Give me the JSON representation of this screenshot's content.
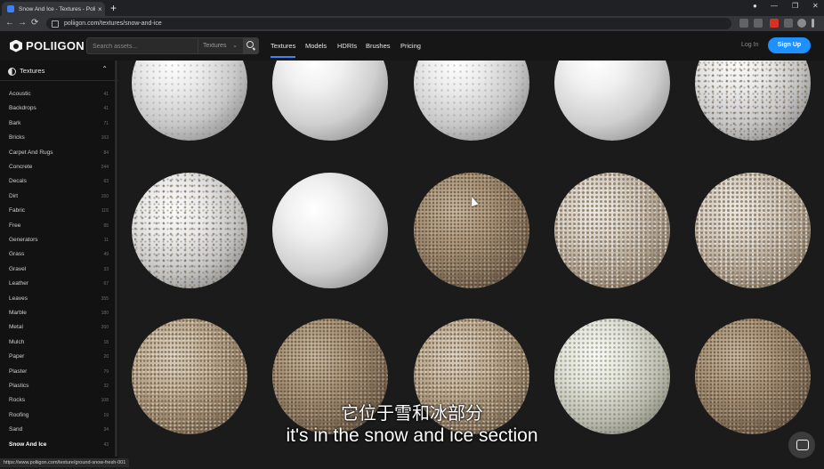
{
  "browser": {
    "tab_title": "Snow And Ice - Textures - Poliig...",
    "tab_close": "×",
    "new_tab": "+",
    "back": "←",
    "forward": "→",
    "reload": "⟳",
    "url": "poliigon.com/textures/snow-and-ice",
    "minimize": "—",
    "maximize": "❐",
    "close": "✕"
  },
  "site": {
    "logo_text": "POLIIGON",
    "search_placeholder": "Search assets...",
    "search_scope": "Textures",
    "nav": [
      {
        "label": "Textures",
        "active": true
      },
      {
        "label": "Models"
      },
      {
        "label": "HDRIs"
      },
      {
        "label": "Brushes"
      },
      {
        "label": "Pricing"
      }
    ],
    "login": "Log In",
    "signup": "Sign Up"
  },
  "sidebar": {
    "title": "Textures",
    "collapse_glyph": "⌃",
    "categories": [
      {
        "name": "Acoustic",
        "count": "41"
      },
      {
        "name": "Backdrops",
        "count": "41"
      },
      {
        "name": "Bark",
        "count": "71"
      },
      {
        "name": "Bricks",
        "count": "163"
      },
      {
        "name": "Carpet And Rugs",
        "count": "84"
      },
      {
        "name": "Concrete",
        "count": "244"
      },
      {
        "name": "Decals",
        "count": "63"
      },
      {
        "name": "Dirt",
        "count": "150"
      },
      {
        "name": "Fabric",
        "count": "115"
      },
      {
        "name": "Free",
        "count": "65"
      },
      {
        "name": "Generators",
        "count": "11"
      },
      {
        "name": "Grass",
        "count": "49"
      },
      {
        "name": "Gravel",
        "count": "33"
      },
      {
        "name": "Leather",
        "count": "67"
      },
      {
        "name": "Leaves",
        "count": "355"
      },
      {
        "name": "Marble",
        "count": "180"
      },
      {
        "name": "Metal",
        "count": "260"
      },
      {
        "name": "Mulch",
        "count": "18"
      },
      {
        "name": "Paper",
        "count": "20"
      },
      {
        "name": "Plaster",
        "count": "79"
      },
      {
        "name": "Plastics",
        "count": "32"
      },
      {
        "name": "Rocks",
        "count": "108"
      },
      {
        "name": "Roofing",
        "count": "19"
      },
      {
        "name": "Sand",
        "count": "34"
      },
      {
        "name": "Snow And Ice",
        "count": "43",
        "selected": true
      }
    ]
  },
  "textures": [
    {
      "style": "rough"
    },
    {
      "style": "white"
    },
    {
      "style": "rough"
    },
    {
      "style": "white"
    },
    {
      "style": "speck"
    },
    {
      "style": "speck"
    },
    {
      "style": "white"
    },
    {
      "style": "ground"
    },
    {
      "style": "heavy"
    },
    {
      "style": "heavy"
    },
    {
      "style": "dryground"
    },
    {
      "style": "ground"
    },
    {
      "style": "dryground"
    },
    {
      "style": "greenish"
    },
    {
      "style": "ground"
    }
  ],
  "subtitles": {
    "chinese": "它位于雪和冰部分",
    "english": "it's in the snow and ice section"
  },
  "status_url": "https://www.poliigon.com/texture/ground-snow-fresh-001",
  "colors": {
    "accent": "#1e90ff",
    "background": "#1b1b1b",
    "sidebar": "#121212"
  }
}
